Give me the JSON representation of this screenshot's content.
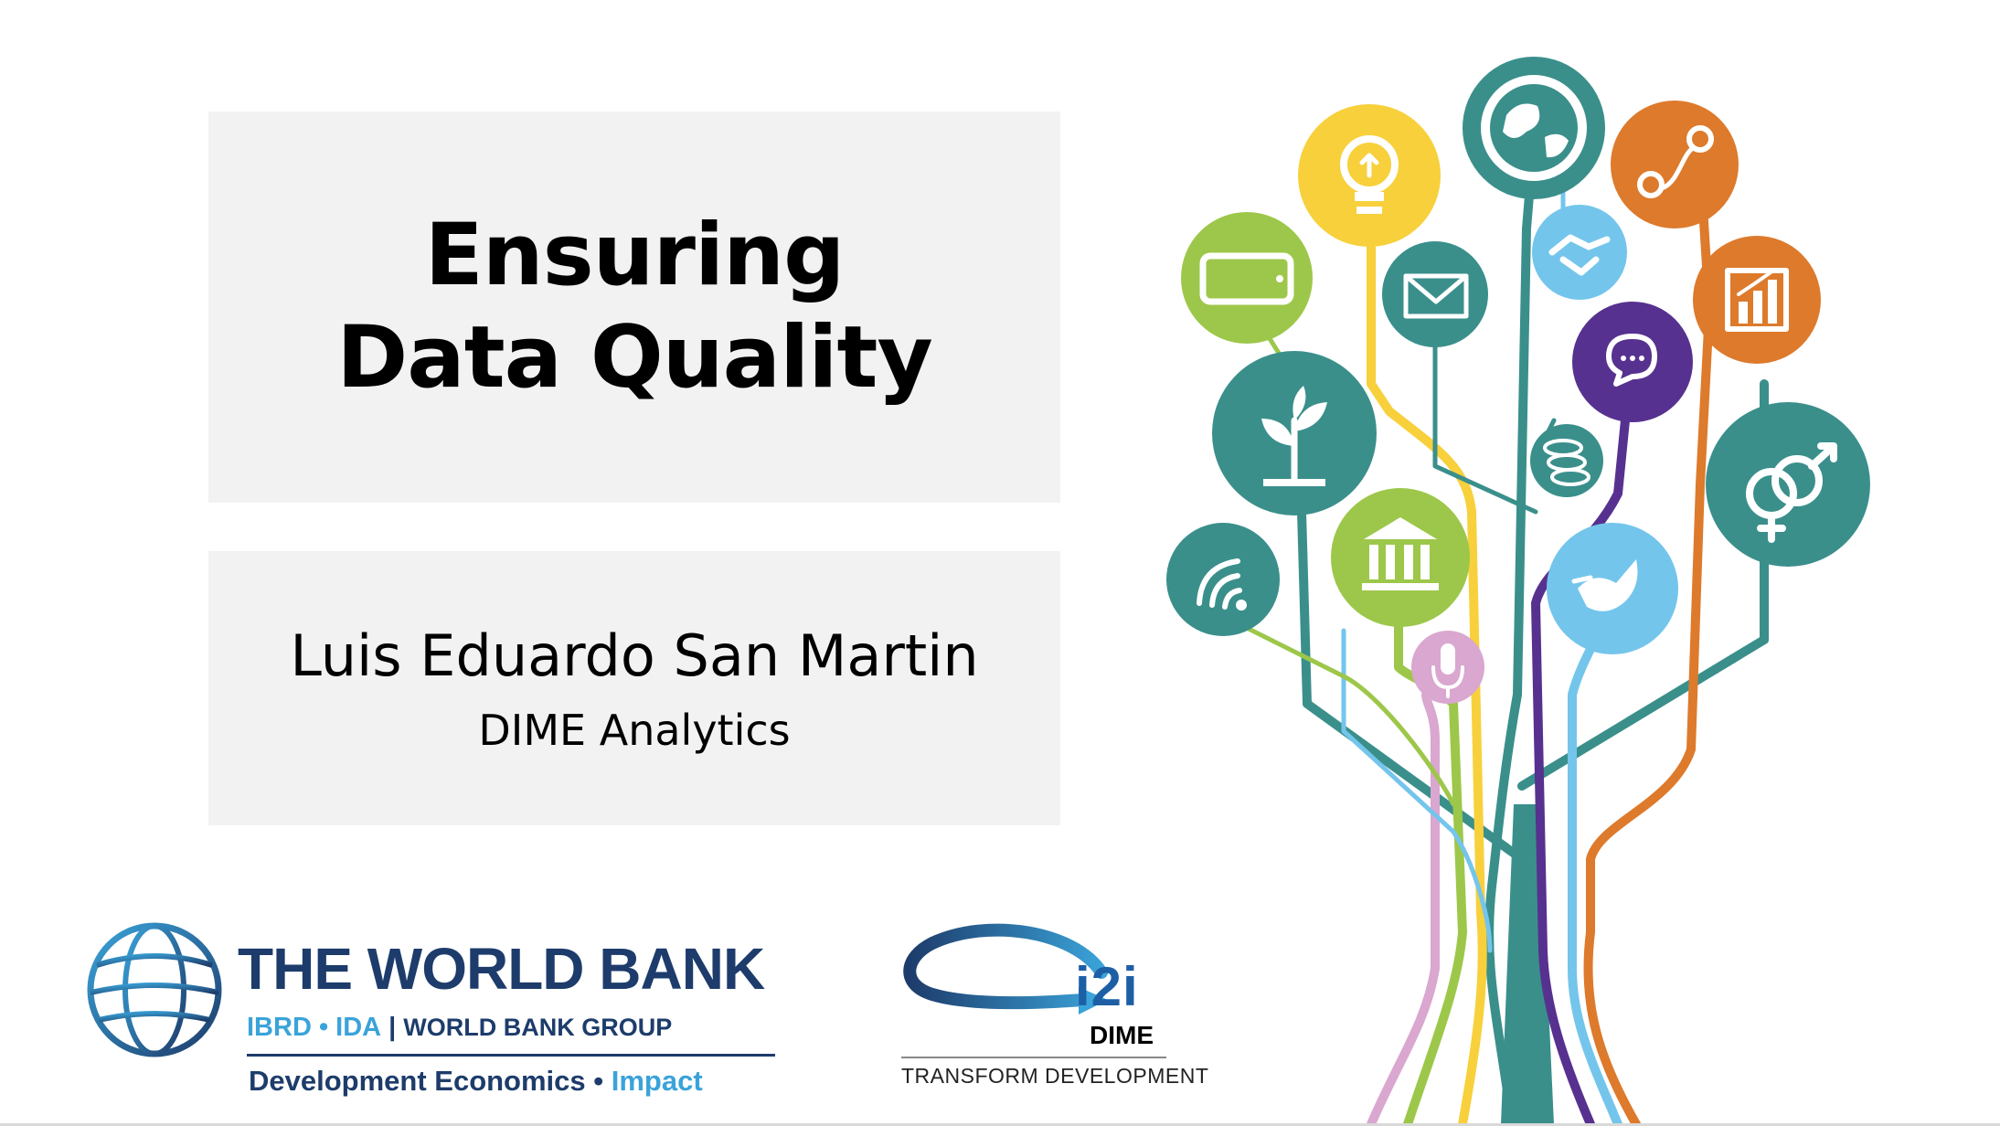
{
  "slide": {
    "title": "Ensuring Data Quality",
    "author": "Luis Eduardo San Martin",
    "organization": "DIME Analytics"
  },
  "world_bank_logo": {
    "name": "THE WORLD BANK",
    "ibrd_ida": "IBRD • IDA",
    "separator": "|",
    "group": "WORLD BANK GROUP",
    "tagline_main": "Development Economics • ",
    "tagline_accent": "Impact"
  },
  "dime_logo": {
    "mark": "i2i",
    "label": "DIME",
    "tagline": "TRANSFORM DEVELOPMENT"
  },
  "colors": {
    "teal": "#3a8f8b",
    "yellow": "#f7d03c",
    "green": "#9dc74a",
    "orange": "#dd7a2c",
    "purple": "#57318f",
    "light_blue": "#74c5ec",
    "pink": "#d9a7cf",
    "navy": "#1d3c6b",
    "wb_light_blue": "#3aa3d9"
  },
  "tree_icons": [
    "globe-icon",
    "lightbulb-icon",
    "map-route-icon",
    "tablet-icon",
    "envelope-icon",
    "handshake-icon",
    "chart-icon",
    "chat-icon",
    "plant-icon",
    "coins-icon",
    "gender-icon",
    "wifi-icon",
    "institution-icon",
    "dove-icon",
    "microphone-icon"
  ]
}
